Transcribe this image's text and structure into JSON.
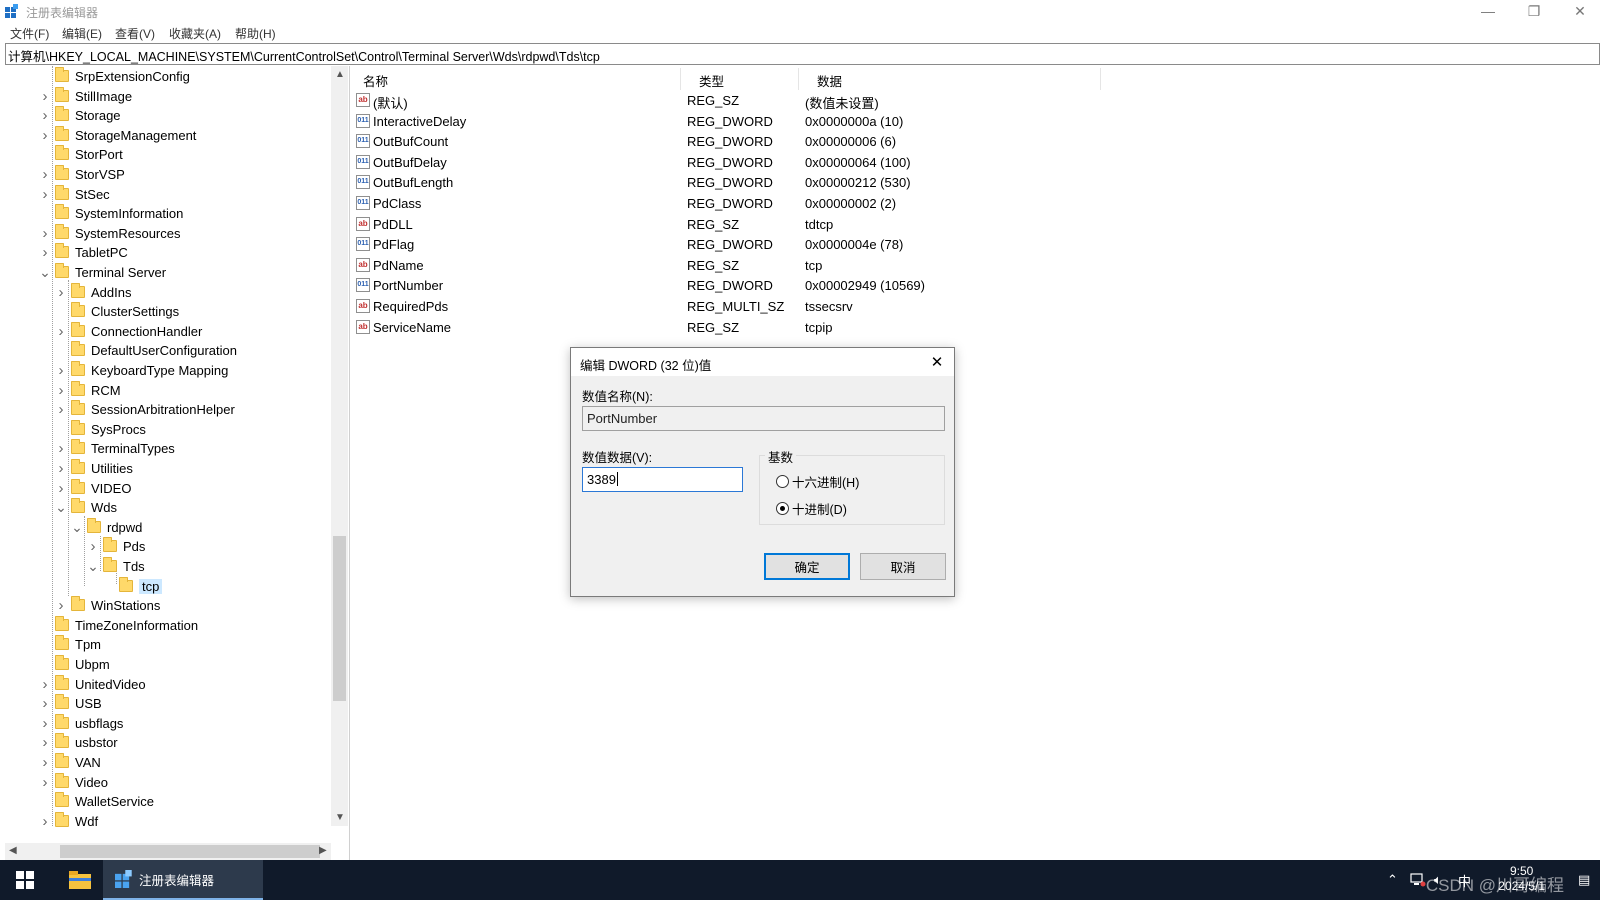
{
  "window": {
    "title": "注册表编辑器",
    "minimize_glyph": "—",
    "restore_glyph": "❐",
    "close_glyph": "✕"
  },
  "menu": [
    "文件(F)",
    "编辑(E)",
    "查看(V)",
    "收藏夹(A)",
    "帮助(H)"
  ],
  "address": "计算机\\HKEY_LOCAL_MACHINE\\SYSTEM\\CurrentControlSet\\Control\\Terminal Server\\Wds\\rdpwd\\Tds\\tcp",
  "tree": [
    {
      "label": "SrpExtensionConfig",
      "level": 0,
      "toggle": "none"
    },
    {
      "label": "StillImage",
      "level": 0,
      "toggle": "collapsed"
    },
    {
      "label": "Storage",
      "level": 0,
      "toggle": "collapsed"
    },
    {
      "label": "StorageManagement",
      "level": 0,
      "toggle": "collapsed"
    },
    {
      "label": "StorPort",
      "level": 0,
      "toggle": "none"
    },
    {
      "label": "StorVSP",
      "level": 0,
      "toggle": "collapsed"
    },
    {
      "label": "StSec",
      "level": 0,
      "toggle": "collapsed"
    },
    {
      "label": "SystemInformation",
      "level": 0,
      "toggle": "none"
    },
    {
      "label": "SystemResources",
      "level": 0,
      "toggle": "collapsed"
    },
    {
      "label": "TabletPC",
      "level": 0,
      "toggle": "collapsed"
    },
    {
      "label": "Terminal Server",
      "level": 0,
      "toggle": "expanded"
    },
    {
      "label": "AddIns",
      "level": 1,
      "toggle": "collapsed"
    },
    {
      "label": "ClusterSettings",
      "level": 1,
      "toggle": "none"
    },
    {
      "label": "ConnectionHandler",
      "level": 1,
      "toggle": "collapsed"
    },
    {
      "label": "DefaultUserConfiguration",
      "level": 1,
      "toggle": "none"
    },
    {
      "label": "KeyboardType Mapping",
      "level": 1,
      "toggle": "collapsed"
    },
    {
      "label": "RCM",
      "level": 1,
      "toggle": "collapsed"
    },
    {
      "label": "SessionArbitrationHelper",
      "level": 1,
      "toggle": "collapsed"
    },
    {
      "label": "SysProcs",
      "level": 1,
      "toggle": "none"
    },
    {
      "label": "TerminalTypes",
      "level": 1,
      "toggle": "collapsed"
    },
    {
      "label": "Utilities",
      "level": 1,
      "toggle": "collapsed"
    },
    {
      "label": "VIDEO",
      "level": 1,
      "toggle": "collapsed"
    },
    {
      "label": "Wds",
      "level": 1,
      "toggle": "expanded"
    },
    {
      "label": "rdpwd",
      "level": 2,
      "toggle": "expanded"
    },
    {
      "label": "Pds",
      "level": 3,
      "toggle": "collapsed"
    },
    {
      "label": "Tds",
      "level": 3,
      "toggle": "expanded"
    },
    {
      "label": "tcp",
      "level": 4,
      "toggle": "none",
      "selected": true
    },
    {
      "label": "WinStations",
      "level": 1,
      "toggle": "collapsed"
    },
    {
      "label": "TimeZoneInformation",
      "level": 0,
      "toggle": "none"
    },
    {
      "label": "Tpm",
      "level": 0,
      "toggle": "none"
    },
    {
      "label": "Ubpm",
      "level": 0,
      "toggle": "none"
    },
    {
      "label": "UnitedVideo",
      "level": 0,
      "toggle": "collapsed"
    },
    {
      "label": "USB",
      "level": 0,
      "toggle": "collapsed"
    },
    {
      "label": "usbflags",
      "level": 0,
      "toggle": "collapsed"
    },
    {
      "label": "usbstor",
      "level": 0,
      "toggle": "collapsed"
    },
    {
      "label": "VAN",
      "level": 0,
      "toggle": "collapsed"
    },
    {
      "label": "Video",
      "level": 0,
      "toggle": "collapsed"
    },
    {
      "label": "WalletService",
      "level": 0,
      "toggle": "none"
    },
    {
      "label": "Wdf",
      "level": 0,
      "toggle": "collapsed"
    }
  ],
  "list": {
    "headers": {
      "name": "名称",
      "type": "类型",
      "data": "数据"
    },
    "rows": [
      {
        "icon": "string-value-icon",
        "icon_text": "ab",
        "name": "(默认)",
        "type": "REG_SZ",
        "data": "(数值未设置)"
      },
      {
        "icon": "binary-value-icon",
        "icon_text": "011",
        "name": "InteractiveDelay",
        "type": "REG_DWORD",
        "data": "0x0000000a (10)"
      },
      {
        "icon": "binary-value-icon",
        "icon_text": "011",
        "name": "OutBufCount",
        "type": "REG_DWORD",
        "data": "0x00000006 (6)"
      },
      {
        "icon": "binary-value-icon",
        "icon_text": "011",
        "name": "OutBufDelay",
        "type": "REG_DWORD",
        "data": "0x00000064 (100)"
      },
      {
        "icon": "binary-value-icon",
        "icon_text": "011",
        "name": "OutBufLength",
        "type": "REG_DWORD",
        "data": "0x00000212 (530)"
      },
      {
        "icon": "binary-value-icon",
        "icon_text": "011",
        "name": "PdClass",
        "type": "REG_DWORD",
        "data": "0x00000002 (2)"
      },
      {
        "icon": "string-value-icon",
        "icon_text": "ab",
        "name": "PdDLL",
        "type": "REG_SZ",
        "data": "tdtcp"
      },
      {
        "icon": "binary-value-icon",
        "icon_text": "011",
        "name": "PdFlag",
        "type": "REG_DWORD",
        "data": "0x0000004e (78)"
      },
      {
        "icon": "string-value-icon",
        "icon_text": "ab",
        "name": "PdName",
        "type": "REG_SZ",
        "data": "tcp"
      },
      {
        "icon": "binary-value-icon",
        "icon_text": "011",
        "name": "PortNumber",
        "type": "REG_DWORD",
        "data": "0x00002949 (10569)"
      },
      {
        "icon": "string-value-icon",
        "icon_text": "ab",
        "name": "RequiredPds",
        "type": "REG_MULTI_SZ",
        "data": "tssecsrv"
      },
      {
        "icon": "string-value-icon",
        "icon_text": "ab",
        "name": "ServiceName",
        "type": "REG_SZ",
        "data": "tcpip"
      }
    ]
  },
  "dialog": {
    "title": "编辑 DWORD (32 位)值",
    "name_label": "数值名称(N):",
    "name_value": "PortNumber",
    "data_label": "数值数据(V):",
    "data_value": "3389",
    "base_label": "基数",
    "radio_hex": "十六进制(H)",
    "radio_dec": "十进制(D)",
    "selected_base": "decimal",
    "ok": "确定",
    "cancel": "取消"
  },
  "taskbar": {
    "app_label": "注册表编辑器",
    "tray_lang": "中",
    "time": "9:50",
    "date": "2024/5/1",
    "watermark": "CSDN @川哥编程"
  }
}
